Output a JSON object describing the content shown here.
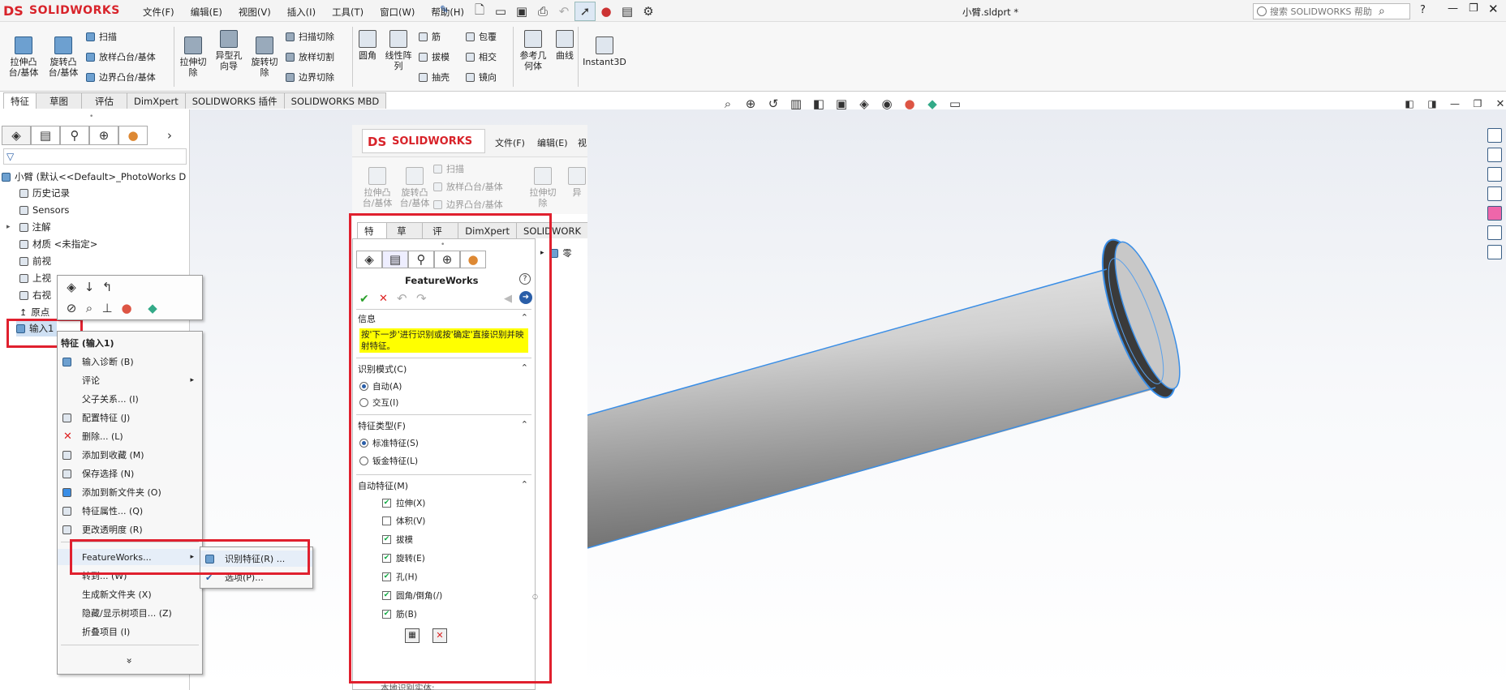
{
  "app": {
    "logo": "SOLIDWORKS",
    "title": "小臂.sldprt *",
    "search_placeholder": "搜索 SOLIDWORKS 帮助",
    "menu": [
      "文件(F)",
      "编辑(E)",
      "视图(V)",
      "插入(I)",
      "工具(T)",
      "窗口(W)",
      "帮助(H)"
    ],
    "help_q": "?"
  },
  "ribbon": {
    "extrude_boss": "拉伸凸\n台/基体",
    "revolve_boss": "旋转凸\n台/基体",
    "sweep": "扫描",
    "loft_boss": "放样凸台/基体",
    "boundary_boss": "边界凸台/基体",
    "extrude_cut": "拉伸切\n除",
    "hole_wizard": "异型孔\n向导",
    "revolve_cut": "旋转切\n除",
    "sweep_cut": "扫描切除",
    "loft_cut": "放样切割",
    "boundary_cut": "边界切除",
    "fillet": "圆角",
    "linear_pattern": "线性阵\n列",
    "rib": "筋",
    "draft": "拔模",
    "shell": "抽壳",
    "wrap": "包覆",
    "intersect": "相交",
    "mirror": "镜向",
    "ref_geom": "参考几\n何体",
    "curves": "曲线",
    "instant3d": "Instant3D"
  },
  "tabs": [
    "特征",
    "草图",
    "评估",
    "DimXpert",
    "SOLIDWORKS 插件",
    "SOLIDWORKS MBD"
  ],
  "tree": {
    "root": "小臂  (默认<<Default>_PhotoWorks D",
    "items": [
      "历史记录",
      "Sensors",
      "注解",
      "材质 <未指定>",
      "前视",
      "上视",
      "右视",
      "原点",
      "输入1"
    ]
  },
  "context_menu": {
    "title": "特征 (输入1)",
    "items": [
      "输入诊断 (B)",
      "评论",
      "父子关系... (I)",
      "配置特征 (J)",
      "删除... (L)",
      "添加到收藏 (M)",
      "保存选择 (N)",
      "添加到新文件夹 (O)",
      "特征属性... (Q)",
      "更改透明度 (R)",
      "FeatureWorks...",
      "转到... (W)",
      "生成新文件夹 (X)",
      "隐藏/显示树项目... (Z)",
      "折叠项目 (I)"
    ],
    "more": "»"
  },
  "submenu": {
    "items": [
      "识别特征(R) ...",
      "选项(P)..."
    ]
  },
  "inset": {
    "logo": "SOLIDWORKS",
    "menu": [
      "文件(F)",
      "编辑(E)",
      "视"
    ],
    "ribbon": {
      "extrude_boss": "拉伸凸\n台/基体",
      "revolve_boss": "旋转凸\n台/基体",
      "sweep": "扫描",
      "loft_boss": "放样凸台/基体",
      "boundary_boss": "边界凸台/基体",
      "extrude_cut": "拉伸切\n除",
      "hole": "异"
    },
    "tabs": [
      "特征",
      "草图",
      "评估",
      "DimXpert",
      "SOLIDWORK"
    ],
    "tree_root": "零"
  },
  "featureworks": {
    "title": "FeatureWorks",
    "info_header": "信息",
    "info_text": "按'下一步'进行识别或按'确定'直接识别并映射特征。",
    "mode_header": "识别模式(C)",
    "mode_options": [
      "自动(A)",
      "交互(I)"
    ],
    "type_header": "特征类型(F)",
    "type_options": [
      "标准特征(S)",
      "钣金特征(L)"
    ],
    "auto_header": "自动特征(M)",
    "auto_options": [
      {
        "label": "拉伸(X)",
        "checked": true
      },
      {
        "label": "体积(V)",
        "checked": false
      },
      {
        "label": "拔模",
        "checked": true
      },
      {
        "label": "旋转(E)",
        "checked": true
      },
      {
        "label": "孔(H)",
        "checked": true
      },
      {
        "label": "圆角/倒角(/)",
        "checked": true
      },
      {
        "label": "筋(B)",
        "checked": true
      }
    ],
    "footer_cut": "本地识别实体:"
  },
  "colors": {
    "accent_red": "#e0202e",
    "info_yellow": "#ffff00",
    "selection_blue": "#3a8ee6"
  }
}
